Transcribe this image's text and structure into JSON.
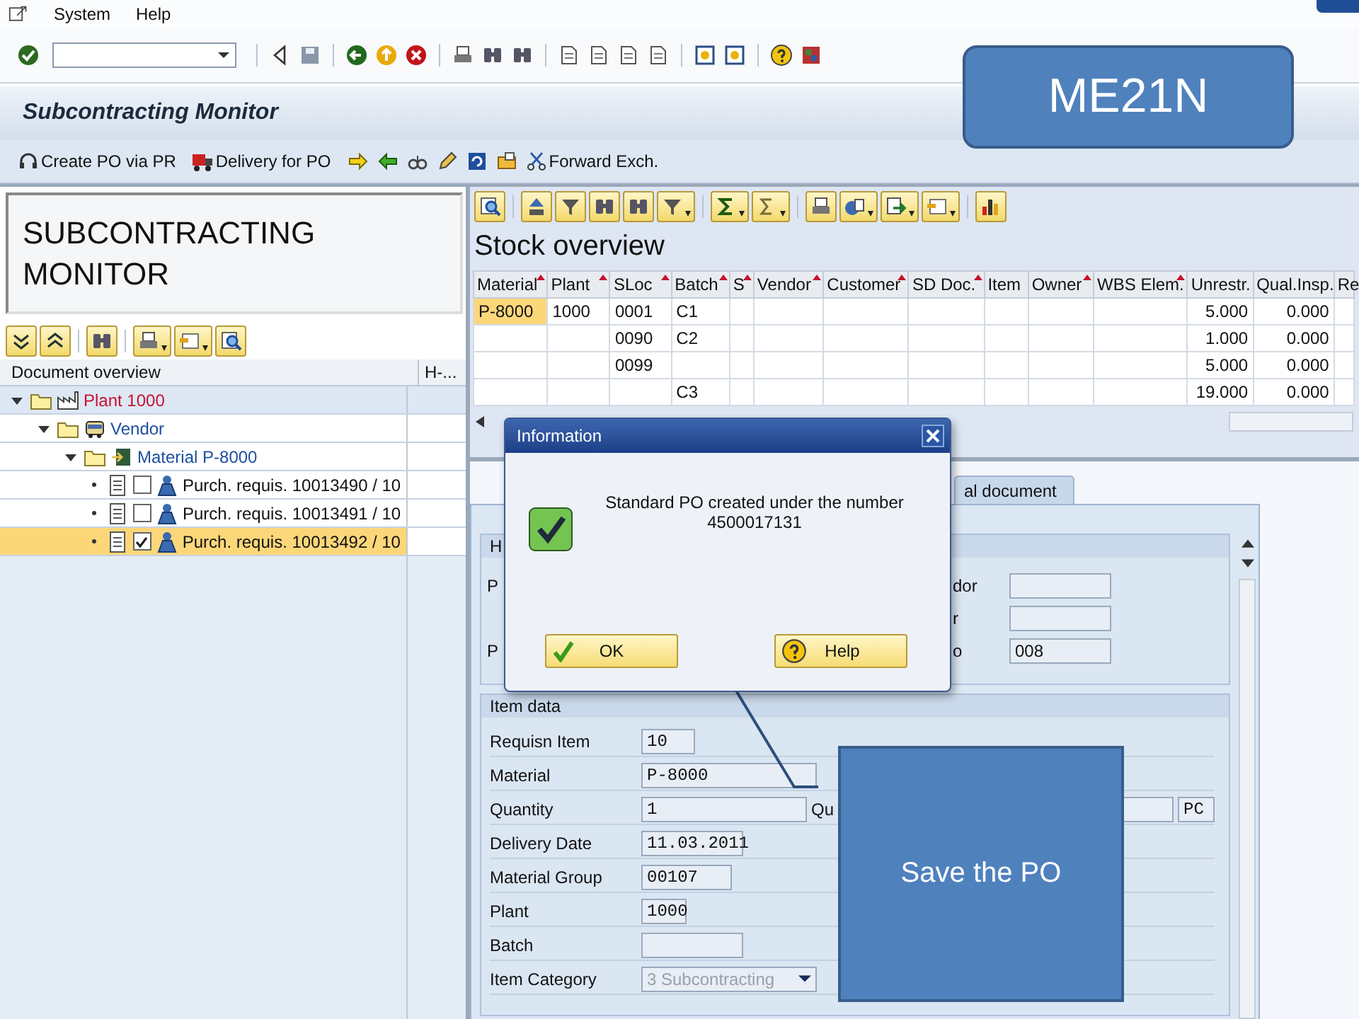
{
  "menu": [
    {
      "label": "System"
    },
    {
      "label": "Help"
    }
  ],
  "title": "Subcontracting Monitor",
  "app_toolbar": [
    {
      "label": "Create PO via PR"
    },
    {
      "label": "Delivery for PO"
    },
    {
      "label": "Forward Exch."
    }
  ],
  "callouts": [
    {
      "kind": "rounded",
      "text": "ME21N"
    },
    {
      "kind": "square",
      "text": "Save the PO"
    }
  ],
  "left_panel": {
    "heading_lines": [
      "SUBCONTRACTING",
      "MONITOR"
    ],
    "tree_columns": [
      "Document overview",
      "H-..."
    ],
    "tree": [
      {
        "kind": "plant",
        "label": "Plant 1000",
        "expanded": true,
        "children": [
          {
            "kind": "vendor",
            "label": "Vendor",
            "expanded": true,
            "children": [
              {
                "kind": "material",
                "label": "Material P-8000",
                "expanded": true,
                "children": [
                  {
                    "kind": "requisition",
                    "label": "Purch. requis. 10013490 / 10",
                    "checked": false,
                    "selected": false
                  },
                  {
                    "kind": "requisition",
                    "label": "Purch. requis. 10013491 / 10",
                    "checked": false,
                    "selected": false
                  },
                  {
                    "kind": "requisition",
                    "label": "Purch. requis. 10013492 / 10",
                    "checked": true,
                    "selected": true
                  }
                ]
              }
            ]
          }
        ]
      }
    ]
  },
  "stock": {
    "title": "Stock overview",
    "columns": [
      {
        "label": "Material",
        "sorted": true
      },
      {
        "label": "Plant",
        "sorted": true
      },
      {
        "label": "SLoc",
        "sorted": true
      },
      {
        "label": "Batch",
        "sorted": true
      },
      {
        "label": "S",
        "sorted": true
      },
      {
        "label": "Vendor",
        "sorted": true
      },
      {
        "label": "Customer",
        "sorted": true
      },
      {
        "label": "SD Doc.",
        "sorted": true
      },
      {
        "label": "Item",
        "sorted": false
      },
      {
        "label": "Owner",
        "sorted": true
      },
      {
        "label": "WBS Elem.",
        "sorted": true
      },
      {
        "label": "Unrestr.",
        "sorted": false
      },
      {
        "label": "Qual.Insp.",
        "sorted": false
      },
      {
        "label": "Re",
        "sorted": false
      }
    ],
    "rows": [
      {
        "selected": true,
        "material": "P-8000",
        "plant": "1000",
        "sloc": "0001",
        "batch": "C1",
        "unrestr": "5.000",
        "qual": "0.000"
      },
      {
        "selected": false,
        "sloc": "0090",
        "batch": "C2",
        "unrestr": "1.000",
        "qual": "0.000"
      },
      {
        "selected": false,
        "sloc": "0099",
        "unrestr": "5.000",
        "qual": "0.000"
      },
      {
        "selected": false,
        "batch": "C3",
        "unrestr": "19.000",
        "qual": "0.000"
      }
    ]
  },
  "tabs": [
    {
      "label": "al document",
      "selected": false
    }
  ],
  "header_data": {
    "title": "H",
    "rows": [
      {
        "left_label": "P",
        "right_label": "dor"
      },
      {
        "right_label": "r"
      },
      {
        "left_label": "P",
        "right_label": "o",
        "value": "008"
      }
    ]
  },
  "item_data": {
    "title": "Item data",
    "rows": [
      {
        "kind": "field",
        "label": "Requisn Item",
        "value": "10"
      },
      {
        "kind": "field",
        "label": "Material",
        "value": "P-8000"
      },
      {
        "kind": "quantity",
        "label": "Quantity",
        "value": "1",
        "extra_label": "Qu",
        "unit": "PC"
      },
      {
        "kind": "field",
        "label": "Delivery Date",
        "value": "11.03.2011"
      },
      {
        "kind": "field",
        "label": "Material Group",
        "value": "00107"
      },
      {
        "kind": "field",
        "label": "Plant",
        "value": "1000"
      },
      {
        "kind": "field",
        "label": "Batch"
      },
      {
        "kind": "dropdown",
        "label": "Item Category",
        "value": "3 Subcontracting",
        "disabled": true
      }
    ]
  },
  "dialog": {
    "title": "Information",
    "message_lines": [
      "Standard PO created under the number",
      "4500017131"
    ],
    "buttons": [
      {
        "kind": "ok",
        "label": "OK"
      },
      {
        "kind": "help",
        "label": "Help"
      }
    ]
  }
}
